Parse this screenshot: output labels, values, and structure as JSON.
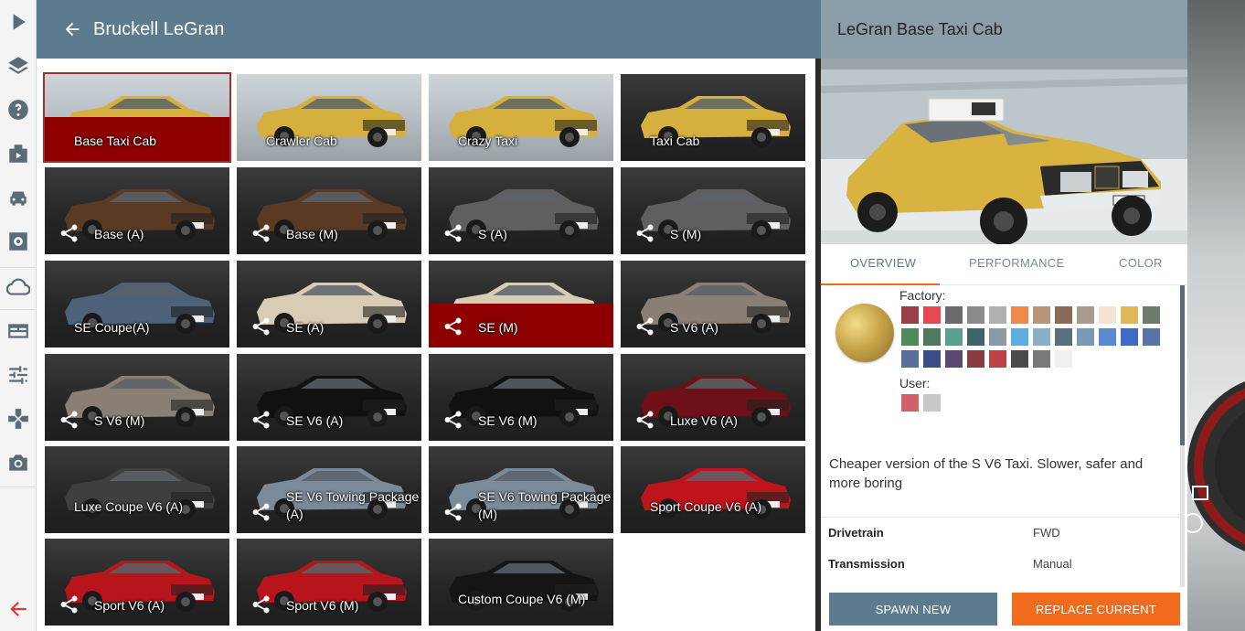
{
  "header": {
    "title": "Bruckell LeGran"
  },
  "sidebar": {
    "icons": [
      "play-icon",
      "layers-icon",
      "help-icon",
      "mission-icon",
      "vehicle-icon",
      "settings-icon",
      "cloud-icon",
      "dashboard-icon",
      "tuning-icon",
      "controls-icon",
      "camera-icon",
      "exit-icon"
    ]
  },
  "configs": [
    {
      "label": "Base Taxi Cab",
      "selected": true,
      "style": "light"
    },
    {
      "label": "Crawler Cab",
      "style": "light"
    },
    {
      "label": "Crazy Taxi",
      "style": "light"
    },
    {
      "label": "Taxi Cab",
      "style": "dark"
    },
    {
      "label": "Base (A)",
      "icon": true,
      "paint": "#5a3a22"
    },
    {
      "label": "Base (M)",
      "icon": true,
      "paint": "#5a3a22"
    },
    {
      "label": "S (A)",
      "icon": true,
      "paint": "#5f5f5f"
    },
    {
      "label": "S (M)",
      "icon": true,
      "paint": "#5f5f5f"
    },
    {
      "label": "SE Coupe(A)",
      "paint": "#4d6178"
    },
    {
      "label": "SE (A)",
      "icon": true,
      "paint": "#d9ccb4"
    },
    {
      "label": "SE (M)",
      "icon": true,
      "paint": "#d9ccb4",
      "hover": true
    },
    {
      "label": "S V6 (A)",
      "icon": true,
      "paint": "#8a7f74"
    },
    {
      "label": "S V6 (M)",
      "icon": true,
      "paint": "#8a7f74"
    },
    {
      "label": "SE V6 (A)",
      "icon": true,
      "paint": "#111111"
    },
    {
      "label": "SE V6 (M)",
      "icon": true,
      "paint": "#111111"
    },
    {
      "label": "Luxe V6 (A)",
      "icon": true,
      "paint": "#6e1018"
    },
    {
      "label": "Luxe Coupe V6 (A)",
      "paint": "#3f3f3f"
    },
    {
      "label": "SE V6 Towing Package (A)",
      "icon": true,
      "paint": "#7b8a99"
    },
    {
      "label": "SE V6 Towing Package (M)",
      "icon": true,
      "paint": "#7b8a99"
    },
    {
      "label": "Sport Coupe V6 (A)",
      "paint": "#c0141c"
    },
    {
      "label": "Sport V6 (A)",
      "icon": true,
      "paint": "#b8141c"
    },
    {
      "label": "Sport V6 (M)",
      "icon": true,
      "paint": "#b8141c"
    },
    {
      "label": "Custom Coupe V6 (M)",
      "paint": "#151515"
    }
  ],
  "detail": {
    "title": "LeGran Base Taxi Cab",
    "tabs": [
      "OVERVIEW",
      "PERFORMANCE",
      "COLOR"
    ],
    "active_tab": "OVERVIEW",
    "factory_label": "Factory:",
    "user_label": "User:",
    "factory_colors": [
      "#9b3d46",
      "#e8474f",
      "#6b6b6b",
      "#8a8a8a",
      "#b0b0b0",
      "#f0884a",
      "#b8957a",
      "#8a6b5a",
      "#a89a8c",
      "#f4e4d4",
      "#e0b857",
      "#6e7a6a",
      "#4d8a5c",
      "#4f7a5e",
      "#5aa090",
      "#3e6468",
      "#8a9aa4",
      "#5ab0e0",
      "#8ab0c8",
      "#5a6e7c",
      "#7a9ab4",
      "#5a8ad0",
      "#3c6cc4",
      "#5a74a8",
      "#5a6e9e",
      "#3c4e88",
      "#5a4a70",
      "#8a3c44",
      "#c04048",
      "#4a4a4a",
      "#787878",
      "#f0f0f0"
    ],
    "user_colors": [
      "#d0606a",
      "#c8c8c8"
    ],
    "description": "Cheaper version of the S V6 Taxi. Slower, safer and more boring",
    "specs": [
      {
        "key": "Drivetrain",
        "value": "FWD"
      },
      {
        "key": "Transmission",
        "value": "Manual"
      }
    ],
    "spawn_label": "SPAWN NEW",
    "replace_label": "REPLACE CURRENT"
  }
}
